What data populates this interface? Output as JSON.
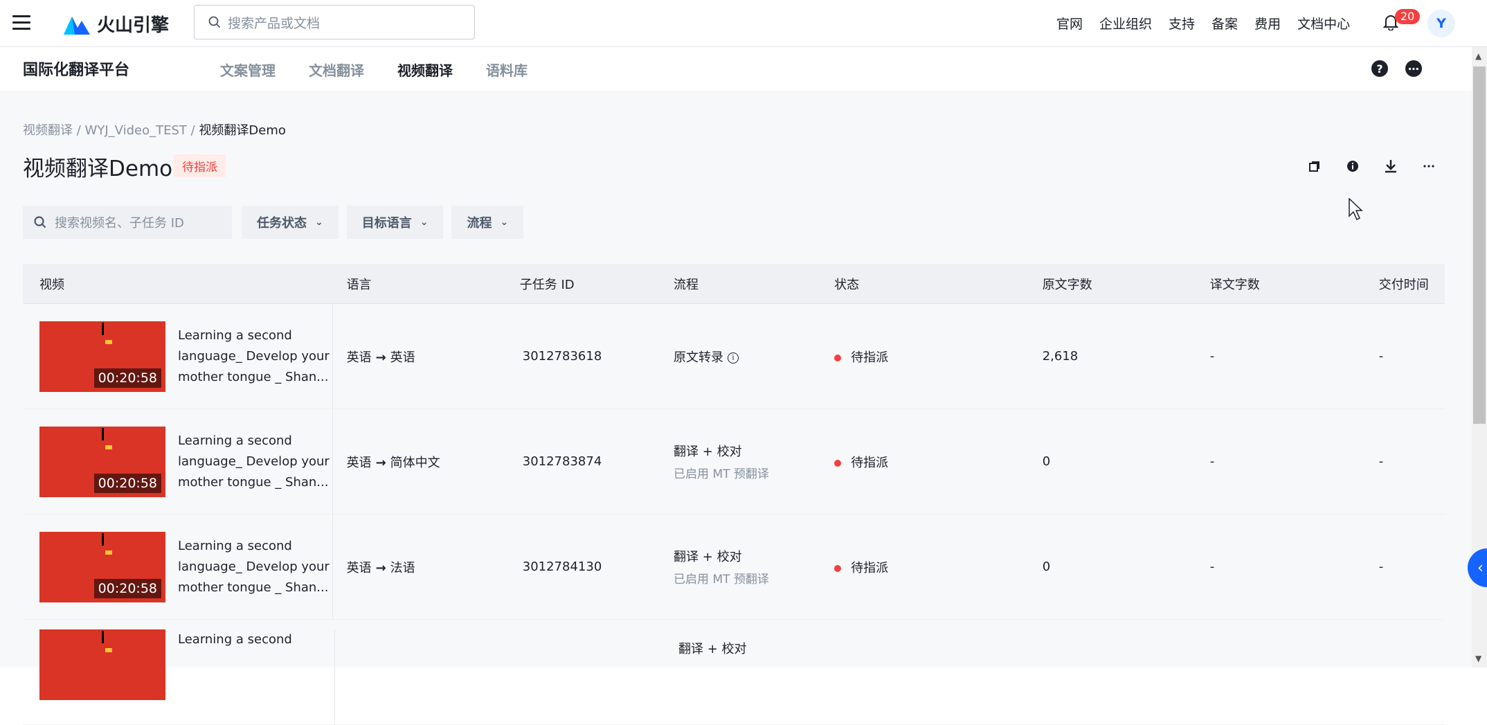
{
  "topbar": {
    "brand": "火山引擎",
    "search_placeholder": "搜索产品或文档",
    "nav": [
      "官网",
      "企业组织",
      "支持",
      "备案",
      "费用",
      "文档中心"
    ],
    "notification_count": "20",
    "avatar_initial": "Y"
  },
  "subheader": {
    "platform": "国际化翻译平台",
    "tabs": [
      "文案管理",
      "文档翻译",
      "视频翻译",
      "语料库"
    ],
    "active_tab": "视频翻译"
  },
  "breadcrumb": {
    "items": [
      "视频翻译",
      "WYJ_Video_TEST",
      "视频翻译Demo"
    ],
    "separator": "/"
  },
  "page": {
    "title": "视频翻译Demo",
    "status": "待指派"
  },
  "filters": {
    "search_placeholder": "搜索视频名、子任务 ID",
    "task_status": "任务状态",
    "target_language": "目标语言",
    "flow": "流程"
  },
  "table": {
    "headers": [
      "视频",
      "语言",
      "子任务 ID",
      "流程",
      "状态",
      "原文字数",
      "译文字数",
      "交付时间"
    ],
    "rows": [
      {
        "video_title": "Learning a second language_ Develop your mother tongue _ Shan...",
        "duration": "00:20:58",
        "source_lang": "英语",
        "target_lang": "英语",
        "task_id": "3012783618",
        "flow": "原文转录",
        "flow_sub": "",
        "status": "待指派",
        "src_words": "2,618",
        "tgt_words": "-",
        "delivery": "-"
      },
      {
        "video_title": "Learning a second language_ Develop your mother tongue _ Shan...",
        "duration": "00:20:58",
        "source_lang": "英语",
        "target_lang": "简体中文",
        "task_id": "3012783874",
        "flow": "翻译 + 校对",
        "flow_sub": "已启用 MT 预翻译",
        "status": "待指派",
        "src_words": "0",
        "tgt_words": "-",
        "delivery": "-"
      },
      {
        "video_title": "Learning a second language_ Develop your mother tongue _ Shan...",
        "duration": "00:20:58",
        "source_lang": "英语",
        "target_lang": "法语",
        "task_id": "3012784130",
        "flow": "翻译 + 校对",
        "flow_sub": "已启用 MT 预翻译",
        "status": "待指派",
        "src_words": "0",
        "tgt_words": "-",
        "delivery": "-"
      },
      {
        "video_title": "Learning a second",
        "duration": "",
        "source_lang": "",
        "target_lang": "",
        "task_id": "",
        "flow": "翻译 + 校对",
        "flow_sub": "",
        "status": "",
        "src_words": "",
        "tgt_words": "",
        "delivery": ""
      }
    ]
  },
  "colors": {
    "accent": "#1664ff",
    "danger": "#f53f3f",
    "thumb": "#d93425"
  }
}
